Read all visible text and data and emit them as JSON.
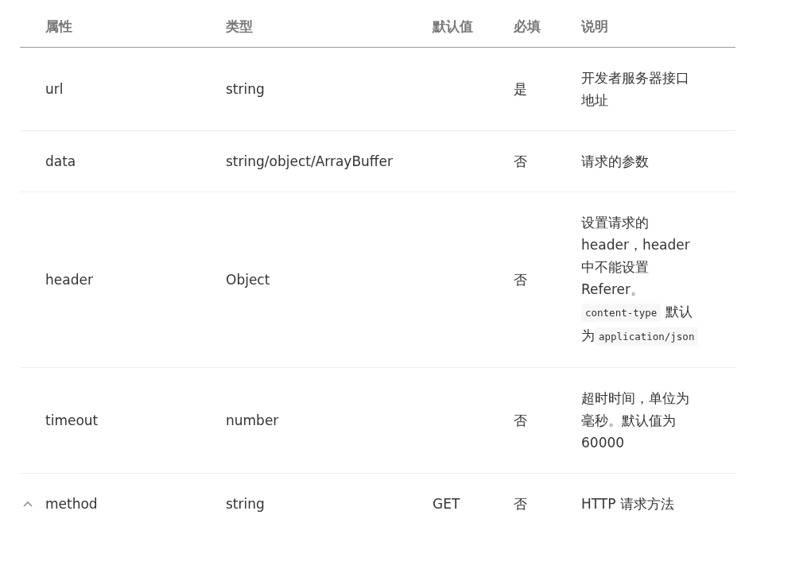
{
  "table": {
    "columns": [
      "属性",
      "类型",
      "默认值",
      "必填",
      "说明"
    ],
    "rows": [
      {
        "collapsible": false,
        "name": "url",
        "type": "string",
        "default": "",
        "required": "是",
        "description": [
          {
            "kind": "text",
            "text": "开发者服务器接口地址"
          }
        ]
      },
      {
        "collapsible": false,
        "name": "data",
        "type": "string/object/ArrayBuffer",
        "default": "",
        "required": "否",
        "description": [
          {
            "kind": "text",
            "text": "请求的参数"
          }
        ]
      },
      {
        "collapsible": false,
        "name": "header",
        "type": "Object",
        "default": "",
        "required": "否",
        "description": [
          {
            "kind": "text",
            "text": "设置请求的header，header中不能设置Referer。"
          },
          {
            "kind": "code",
            "text": "content-type"
          },
          {
            "kind": "text",
            "text": " 默认为"
          },
          {
            "kind": "code",
            "text": "application/json"
          }
        ]
      },
      {
        "collapsible": false,
        "name": "timeout",
        "type": "number",
        "default": "",
        "required": "否",
        "description": [
          {
            "kind": "text",
            "text": "超时时间，单位为毫秒。默认值为60000"
          }
        ]
      },
      {
        "collapsible": true,
        "name": "method",
        "type": "string",
        "default": "GET",
        "required": "否",
        "description": [
          {
            "kind": "text",
            "text": "HTTP 请求方法"
          }
        ]
      }
    ]
  }
}
